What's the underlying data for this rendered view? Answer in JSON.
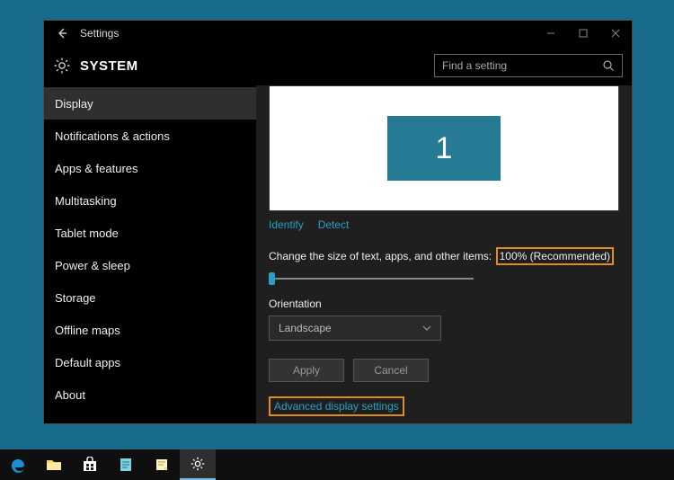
{
  "window": {
    "title": "Settings",
    "header_title": "SYSTEM"
  },
  "search": {
    "placeholder": "Find a setting"
  },
  "sidebar": {
    "items": [
      {
        "label": "Display",
        "selected": true
      },
      {
        "label": "Notifications & actions",
        "selected": false
      },
      {
        "label": "Apps & features",
        "selected": false
      },
      {
        "label": "Multitasking",
        "selected": false
      },
      {
        "label": "Tablet mode",
        "selected": false
      },
      {
        "label": "Power & sleep",
        "selected": false
      },
      {
        "label": "Storage",
        "selected": false
      },
      {
        "label": "Offline maps",
        "selected": false
      },
      {
        "label": "Default apps",
        "selected": false
      },
      {
        "label": "About",
        "selected": false
      }
    ]
  },
  "display": {
    "monitor_number": "1",
    "identify_label": "Identify",
    "detect_label": "Detect",
    "scale_label_prefix": "Change the size of text, apps, and other items:",
    "scale_value": "100% (Recommended)",
    "orientation_label": "Orientation",
    "orientation_value": "Landscape",
    "apply_label": "Apply",
    "cancel_label": "Cancel",
    "advanced_link": "Advanced display settings"
  },
  "colors": {
    "accent": "#2a9fc5",
    "highlight": "#e08a1f"
  }
}
